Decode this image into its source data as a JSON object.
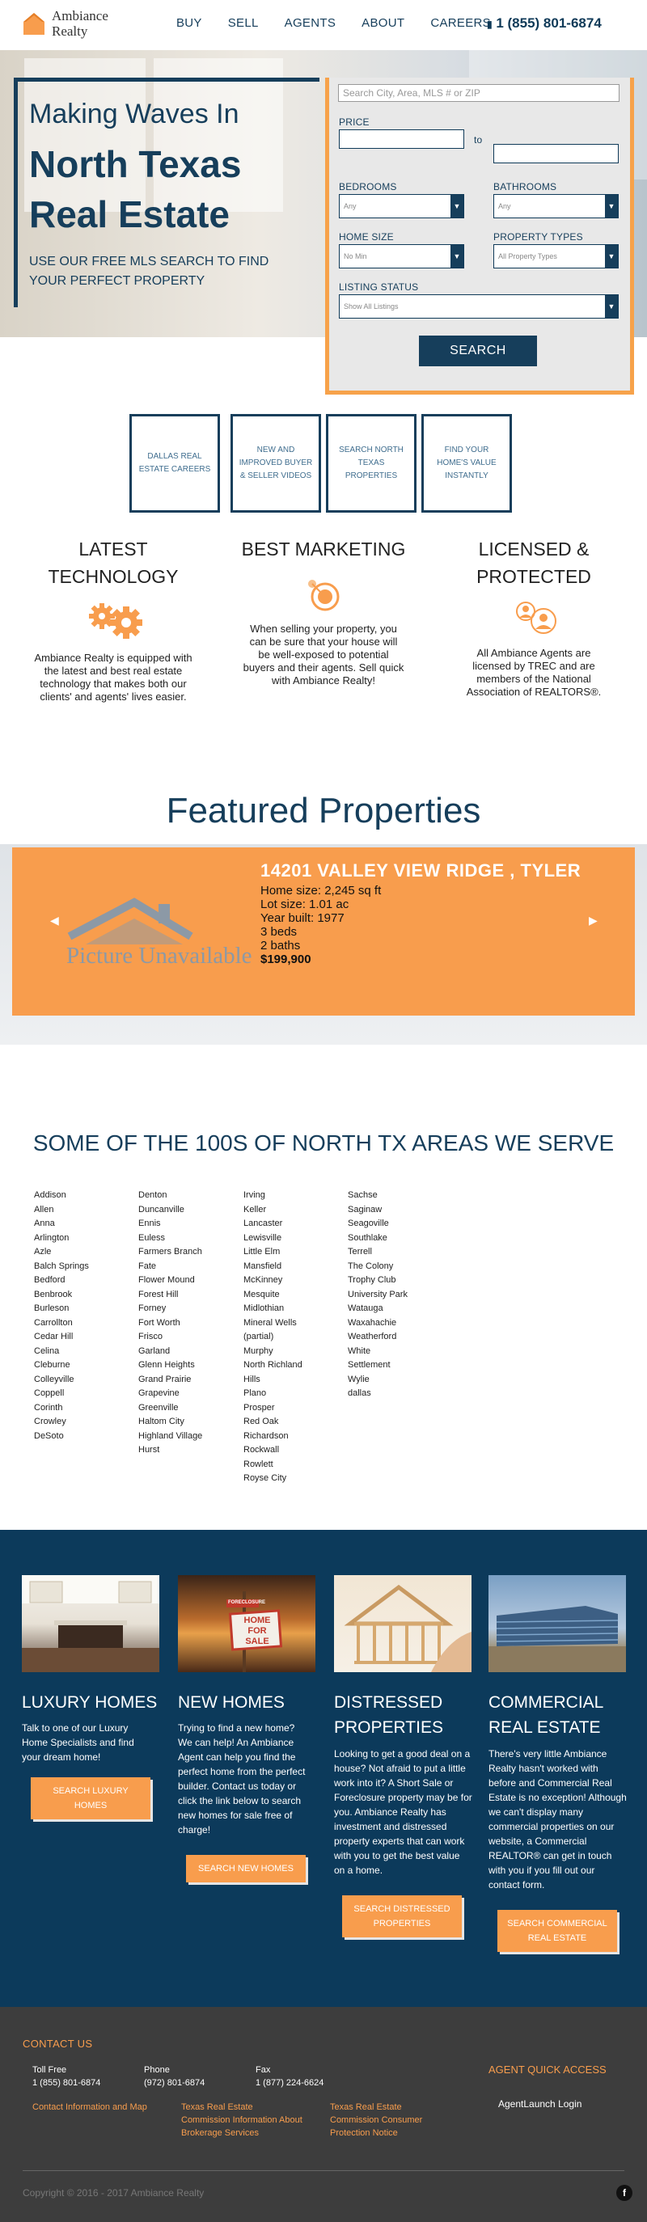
{
  "header": {
    "logo_line1": "Ambiance",
    "logo_line2": "Realty",
    "nav": [
      "BUY",
      "SELL",
      "AGENTS",
      "ABOUT",
      "CAREERS"
    ],
    "phone_icon": "phone-icon",
    "phone": "1 (855) 801-6874"
  },
  "hero": {
    "line1": "Making Waves In",
    "line2": "North Texas Real Estate",
    "sub": "USE OUR FREE MLS SEARCH TO FIND YOUR PERFECT PROPERTY"
  },
  "search": {
    "placeholder": "Search City, Area, MLS # or ZIP",
    "price_label": "PRICE",
    "to_label": "to",
    "bedrooms_label": "BEDROOMS",
    "bedrooms_value": "Any",
    "bathrooms_label": "BATHROOMS",
    "bathrooms_value": "Any",
    "home_size_label": "HOME SIZE",
    "home_size_value": "No Min",
    "property_types_label": "PROPERTY TYPES",
    "property_types_value": "All Property Types",
    "listing_status_label": "LISTING STATUS",
    "listing_status_value": "Show All Listings",
    "button": "SEARCH"
  },
  "tiles": [
    "DALLAS REAL ESTATE CAREERS",
    "NEW AND IMPROVED BUYER & SELLER VIDEOS",
    "SEARCH NORTH TEXAS PROPERTIES",
    "FIND YOUR HOME'S VALUE INSTANTLY"
  ],
  "features": [
    {
      "title": "LATEST TECHNOLOGY",
      "icon": "gears-icon",
      "text": "Ambiance Realty is equipped with the latest and best real estate technology that makes both our clients' and agents' lives easier."
    },
    {
      "title": "BEST MARKETING",
      "icon": "target-icon",
      "text": "When selling your property, you can be sure that your house will be well-exposed to potential buyers and their agents. Sell quick with Ambiance Realty!"
    },
    {
      "title": "LICENSED & PROTECTED",
      "icon": "agents-icon",
      "text": "All Ambiance Agents are licensed by TREC and are members of the National Association of REALTORS®."
    }
  ],
  "featured": {
    "title": "Featured Properties",
    "image_text": "Picture Unavailable",
    "name": "14201 VALLEY VIEW RIDGE , TYLER",
    "home_size": "Home size: 2,245 sq ft",
    "lot_size": "Lot size: 1.01 ac",
    "year_built": "Year built: 1977",
    "beds": "3 beds",
    "baths": "2 baths",
    "price": "$199,900",
    "prev_icon": "chevron-left-icon",
    "next_icon": "chevron-right-icon"
  },
  "areas": {
    "title": "SOME OF THE 100S OF NORTH TX AREAS WE SERVE",
    "col1": [
      "Addison",
      "Allen",
      "Anna",
      "Arlington",
      "Azle",
      "Balch Springs",
      "Bedford",
      "Benbrook",
      "Burleson",
      "Carrollton",
      "Cedar Hill",
      "Celina",
      "Cleburne",
      "Colleyville",
      "Coppell",
      "Corinth",
      "Crowley",
      "DeSoto"
    ],
    "col2": [
      "Denton",
      "Duncanville",
      "Ennis",
      "Euless",
      "Farmers Branch",
      "Fate",
      "Flower Mound",
      "Forest Hill",
      "Forney",
      "Fort Worth",
      "Frisco",
      "Garland",
      "Glenn Heights",
      "Grand Prairie",
      "Grapevine",
      "Greenville",
      "Haltom City",
      "Highland Village",
      "Hurst"
    ],
    "col3": [
      "Irving",
      "Keller",
      "Lancaster",
      "Lewisville",
      "Little Elm",
      "Mansfield",
      "McKinney",
      "Mesquite",
      "Midlothian",
      "Mineral Wells",
      "(partial)",
      "Murphy",
      "North Richland",
      "Hills",
      "Plano",
      "Prosper",
      "Red Oak",
      "Richardson",
      "Rockwall",
      "Rowlett",
      "Royse City"
    ],
    "col4": [
      "Sachse",
      "Saginaw",
      "Seagoville",
      "Southlake",
      "Terrell",
      "The Colony",
      "Trophy Club",
      "University Park",
      "Watauga",
      "Waxahachie",
      "Weatherford",
      "White",
      "Settlement",
      "Wylie",
      "dallas"
    ]
  },
  "services": [
    {
      "title": "LUXURY HOMES",
      "text": "Talk to one of our Luxury Home Specialists and find your dream home!",
      "button": "SEARCH LUXURY HOMES"
    },
    {
      "title": "NEW HOMES",
      "text": "Trying to find a new home? We can help! An Ambiance Agent can help you find the perfect home from the perfect builder. Contact us today or click the link below to search new homes for sale free of charge!",
      "button": "SEARCH NEW HOMES",
      "sign_top": "FORECLOSURE",
      "sign_main": "HOME FOR SALE"
    },
    {
      "title": "DISTRESSED PROPERTIES",
      "text": "Looking to get a good deal on a house? Not afraid to put a little work into it? A Short Sale or Foreclosure property may be for you. Ambiance Realty has investment and distressed property experts that can work with you to get the best value on a home.",
      "button": "SEARCH DISTRESSED PROPERTIES"
    },
    {
      "title": "COMMERCIAL REAL ESTATE",
      "text": "There's very little Ambiance Realty hasn't worked with before and Commercial Real Estate is no exception! Although we can't display many commercial properties on our website, a Commercial REALTOR® can get in touch with you if you fill out our contact form.",
      "button": "SEARCH COMMERCIAL REAL ESTATE"
    }
  ],
  "footer": {
    "contact_title": "CONTACT US",
    "toll_free_label": "Toll Free",
    "toll_free": "1 (855) 801-6874",
    "phone_label": "Phone",
    "phone": "(972) 801-6874",
    "fax_label": "Fax",
    "fax": "1 (877) 224-6624",
    "link_contact": "Contact Information and Map",
    "link_trec1": "Texas Real Estate Commission Information About Brokerage Services",
    "link_trec2": "Texas Real Estate Commission Consumer Protection Notice",
    "agent_title": "AGENT QUICK ACCESS",
    "agent_login": "AgentLaunch Login",
    "copyright": "Copyright © 2016 - 2017 Ambiance Realty",
    "facebook": "f"
  }
}
